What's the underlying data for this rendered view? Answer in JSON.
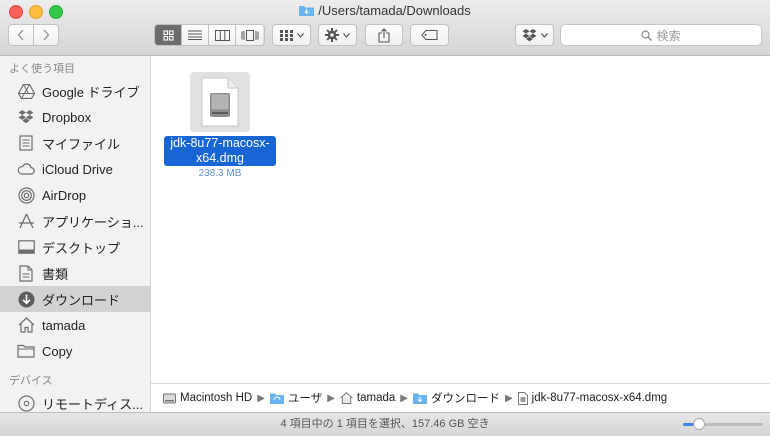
{
  "window": {
    "title": "/Users/tamada/Downloads"
  },
  "toolbar": {
    "search_placeholder": "検索"
  },
  "sidebar": {
    "favorites_header": "よく使う項目",
    "items": [
      {
        "label": "Google ドライブ",
        "icon": "google-drive-icon"
      },
      {
        "label": "Dropbox",
        "icon": "dropbox-icon"
      },
      {
        "label": "マイファイル",
        "icon": "all-my-files-icon"
      },
      {
        "label": "iCloud Drive",
        "icon": "icloud-icon"
      },
      {
        "label": "AirDrop",
        "icon": "airdrop-icon"
      },
      {
        "label": "アプリケーショ...",
        "icon": "applications-icon"
      },
      {
        "label": "デスクトップ",
        "icon": "desktop-icon"
      },
      {
        "label": "書類",
        "icon": "documents-icon"
      },
      {
        "label": "ダウンロード",
        "icon": "downloads-icon",
        "selected": true
      },
      {
        "label": "tamada",
        "icon": "home-icon"
      },
      {
        "label": "Copy",
        "icon": "folder-icon"
      }
    ],
    "devices_header": "デバイス",
    "devices": [
      {
        "label": "リモートディス...",
        "icon": "remote-disc-icon"
      }
    ]
  },
  "content": {
    "files": [
      {
        "name": "jdk-8u77-macosx-x64.dmg",
        "size": "238.3 MB",
        "icon": "disk-image-icon",
        "selected": true
      }
    ]
  },
  "pathbar": {
    "crumbs": [
      {
        "label": "Macintosh HD",
        "icon": "hard-drive-icon"
      },
      {
        "label": "ユーザ",
        "icon": "folder-icon"
      },
      {
        "label": "tamada",
        "icon": "home-icon"
      },
      {
        "label": "ダウンロード",
        "icon": "folder-icon"
      },
      {
        "label": "jdk-8u77-macosx-x64.dmg",
        "icon": "file-icon"
      }
    ]
  },
  "statusbar": {
    "text": "4 項目中の 1 項目を選択、157.46 GB 空き",
    "icon_size_level": 0.2
  },
  "colors": {
    "selection": "#1865d4",
    "accent": "#3d86e6"
  }
}
